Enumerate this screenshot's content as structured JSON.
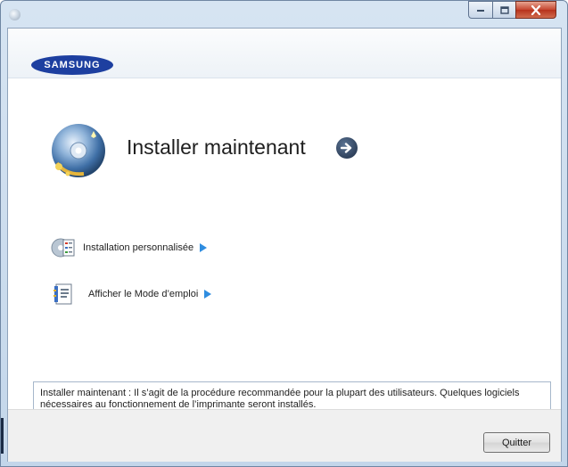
{
  "window": {
    "title": "",
    "controls": {
      "minimize_icon": "minimize-icon",
      "maximize_icon": "maximize-icon",
      "close_icon": "close-icon"
    }
  },
  "header": {
    "logo_text": "SAMSUNG",
    "logo_color": "#1d3fa0"
  },
  "main": {
    "hero": {
      "title": "Installer maintenant",
      "icon": "install-cd-icon",
      "arrow_icon": "arrow-right-circle-icon"
    },
    "options": [
      {
        "label": "Installation personnalisée",
        "icon": "custom-install-icon",
        "arrow_icon": "play-arrow-icon"
      },
      {
        "label": "Afficher le Mode d’emploi",
        "icon": "user-guide-icon",
        "arrow_icon": "play-arrow-icon"
      }
    ],
    "description": "Installer maintenant : Il s’agit de la procédure recommandée pour la plupart des utilisateurs. Quelques logiciels nécessaires au fonctionnement de l’imprimante seront installés."
  },
  "footer": {
    "quit_label": "Quitter"
  }
}
